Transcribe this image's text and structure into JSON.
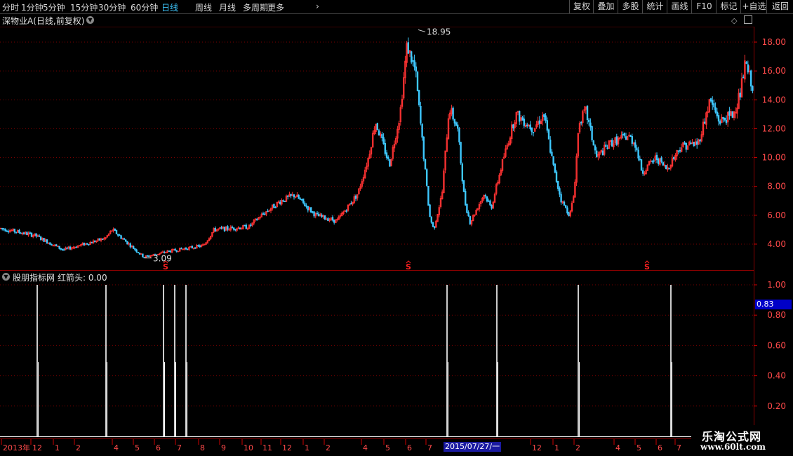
{
  "toolbar": {
    "periods": [
      {
        "label": "分时",
        "active": false
      },
      {
        "label": "1分钟",
        "active": false
      },
      {
        "label": "5分钟",
        "active": false
      },
      {
        "label": "15分钟",
        "active": false
      },
      {
        "label": "30分钟",
        "active": false
      },
      {
        "label": "60分钟",
        "active": false
      },
      {
        "label": "日线",
        "active": true
      },
      {
        "label": "周线",
        "active": false
      },
      {
        "label": "月线",
        "active": false
      },
      {
        "label": "多周期",
        "active": false
      },
      {
        "label": "更多",
        "active": false
      }
    ],
    "right_buttons": [
      "复权",
      "叠加",
      "多股",
      "统计",
      "画线",
      "F10",
      "标记",
      "+自选",
      "返回"
    ]
  },
  "main_chart": {
    "title": "深物业A(日线,前复权)",
    "high_label": "18.95",
    "low_label": "3.09",
    "signal_marker": "S",
    "y_ticks": [
      "18.00",
      "16.00",
      "14.00",
      "12.00",
      "10.00",
      "8.00",
      "6.00",
      "4.00"
    ]
  },
  "indicator": {
    "name": "股朋指标网",
    "series_label": "红箭头: 0.00",
    "current_value": "0.83",
    "y_ticks": [
      "1.00",
      "0.80",
      "0.60",
      "0.40",
      "0.20"
    ]
  },
  "x_axis": {
    "labels": [
      "2013年",
      "12",
      "1",
      "2",
      "4",
      "5",
      "6",
      "7",
      "8",
      "9",
      "10",
      "11",
      "12",
      "1",
      "2",
      "4",
      "5",
      "6",
      "7",
      "12",
      "1",
      "2",
      "4",
      "5",
      "6",
      "7"
    ],
    "cursor_date": "2015/07/27/一"
  },
  "watermark": {
    "line1": "乐淘公式网",
    "line2": "www.60lt.com"
  },
  "chart_data": {
    "type": "candlestick",
    "title": "深物业A(日线,前复权)",
    "price_axis_range": [
      3,
      19
    ],
    "price_high": 18.95,
    "price_low": 3.09,
    "colors": {
      "up": "#ff3232",
      "down": "#3ec8ff",
      "signal": "#ffffff",
      "grid": "#7a0000"
    },
    "indicator_axis_range": [
      0,
      1.1
    ],
    "signals": [
      0.1,
      0.42,
      0.79,
      0.84,
      0.89,
      2.26,
      2.51,
      2.92,
      3.39
    ]
  }
}
